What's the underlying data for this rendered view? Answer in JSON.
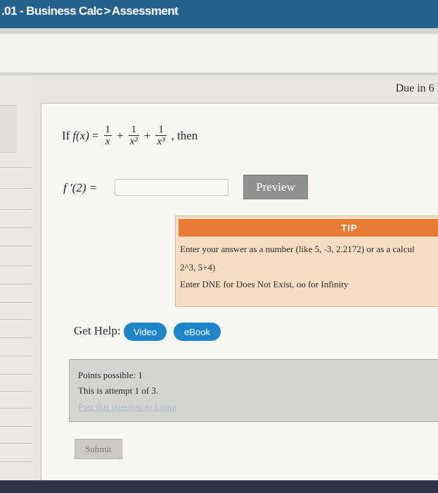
{
  "header": {
    "course": ".01 - Business Calc",
    "separator": ">",
    "section": "Assessment"
  },
  "due_text": "Due in 6 I",
  "question": {
    "prefix": "If",
    "func": "f(x)",
    "equals": "=",
    "terms": [
      {
        "num": "1",
        "den": "x"
      },
      {
        "num": "1",
        "den": "x²"
      },
      {
        "num": "1",
        "den": "x³"
      }
    ],
    "plus": "+",
    "suffix": ", then",
    "answer_label": "f ′(2) =",
    "answer_value": "",
    "preview_label": "Preview"
  },
  "tip": {
    "heading": "TIP",
    "line1": "Enter your answer as a number (like 5, -3, 2.2172) or as a calcul",
    "line2": "2^3, 5+4)",
    "line3": "Enter DNE for Does Not Exist, oo for Infinity"
  },
  "help": {
    "label": "Get Help:",
    "video": "Video",
    "ebook": "eBook"
  },
  "points": {
    "possible": "Points possible: 1",
    "attempt": "This is attempt 1 of 3.",
    "forum_link": "Post this question to forum"
  },
  "submit_label": "Submit",
  "colors": {
    "topbar": "#27628f",
    "tip_header": "#e67b34",
    "pill": "#1d85c8"
  }
}
